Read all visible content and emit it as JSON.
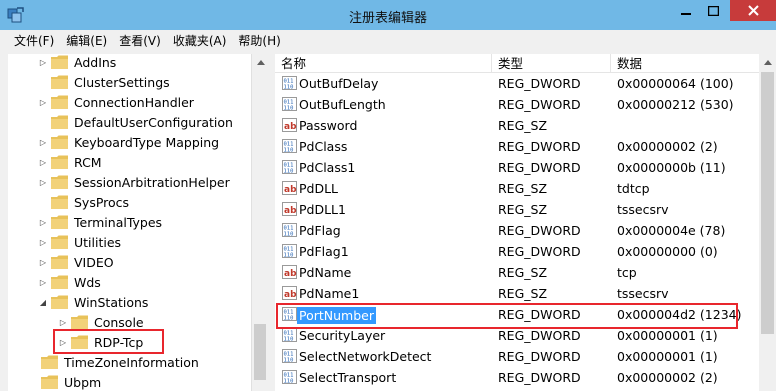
{
  "window": {
    "title": "注册表编辑器",
    "icon": "regedit-icon"
  },
  "menu": [
    {
      "label": "文件(F)"
    },
    {
      "label": "编辑(E)"
    },
    {
      "label": "查看(V)"
    },
    {
      "label": "收藏夹(A)"
    },
    {
      "label": "帮助(H)"
    }
  ],
  "tree": {
    "items": [
      {
        "label": "AddIns",
        "expander": "▷"
      },
      {
        "label": "ClusterSettings",
        "expander": ""
      },
      {
        "label": "ConnectionHandler",
        "expander": "▷"
      },
      {
        "label": "DefaultUserConfiguration",
        "expander": ""
      },
      {
        "label": "KeyboardType Mapping",
        "expander": "▷"
      },
      {
        "label": "RCM",
        "expander": "▷"
      },
      {
        "label": "SessionArbitrationHelper",
        "expander": "▷"
      },
      {
        "label": "SysProcs",
        "expander": ""
      },
      {
        "label": "TerminalTypes",
        "expander": "▷"
      },
      {
        "label": "Utilities",
        "expander": "▷"
      },
      {
        "label": "VIDEO",
        "expander": "▷"
      },
      {
        "label": "Wds",
        "expander": "▷"
      },
      {
        "label": "WinStations",
        "expander": "◢"
      },
      {
        "label": "Console",
        "expander": "▷"
      },
      {
        "label": "RDP-Tcp",
        "expander": "▷"
      },
      {
        "label": "TimeZoneInformation",
        "expander": ""
      },
      {
        "label": "Ubpm",
        "expander": ""
      }
    ]
  },
  "list": {
    "columns": {
      "name": "名称",
      "type": "类型",
      "data": "数据"
    },
    "rows": [
      {
        "name": "OutBufDelay",
        "type": "REG_DWORD",
        "data": "0x00000064 (100)",
        "icon": "dword-icon"
      },
      {
        "name": "OutBufLength",
        "type": "REG_DWORD",
        "data": "0x00000212 (530)",
        "icon": "dword-icon"
      },
      {
        "name": "Password",
        "type": "REG_SZ",
        "data": "",
        "icon": "string-icon"
      },
      {
        "name": "PdClass",
        "type": "REG_DWORD",
        "data": "0x00000002 (2)",
        "icon": "dword-icon"
      },
      {
        "name": "PdClass1",
        "type": "REG_DWORD",
        "data": "0x0000000b (11)",
        "icon": "dword-icon"
      },
      {
        "name": "PdDLL",
        "type": "REG_SZ",
        "data": "tdtcp",
        "icon": "string-icon"
      },
      {
        "name": "PdDLL1",
        "type": "REG_SZ",
        "data": "tssecsrv",
        "icon": "string-icon"
      },
      {
        "name": "PdFlag",
        "type": "REG_DWORD",
        "data": "0x0000004e (78)",
        "icon": "dword-icon"
      },
      {
        "name": "PdFlag1",
        "type": "REG_DWORD",
        "data": "0x00000000 (0)",
        "icon": "dword-icon"
      },
      {
        "name": "PdName",
        "type": "REG_SZ",
        "data": "tcp",
        "icon": "string-icon"
      },
      {
        "name": "PdName1",
        "type": "REG_SZ",
        "data": "tssecsrv",
        "icon": "string-icon"
      },
      {
        "name": "PortNumber",
        "type": "REG_DWORD",
        "data": "0x000004d2 (1234)",
        "icon": "dword-icon"
      },
      {
        "name": "SecurityLayer",
        "type": "REG_DWORD",
        "data": "0x00000001 (1)",
        "icon": "dword-icon"
      },
      {
        "name": "SelectNetworkDetect",
        "type": "REG_DWORD",
        "data": "0x00000001 (1)",
        "icon": "dword-icon"
      },
      {
        "name": "SelectTransport",
        "type": "REG_DWORD",
        "data": "0x00000002 (2)",
        "icon": "dword-icon"
      }
    ]
  },
  "colors": {
    "titlebar": "#70b8e6",
    "close": "#c73b3b",
    "selection": "#3399ff",
    "highlight": "#e8262d",
    "folder": "#e8c25a"
  }
}
